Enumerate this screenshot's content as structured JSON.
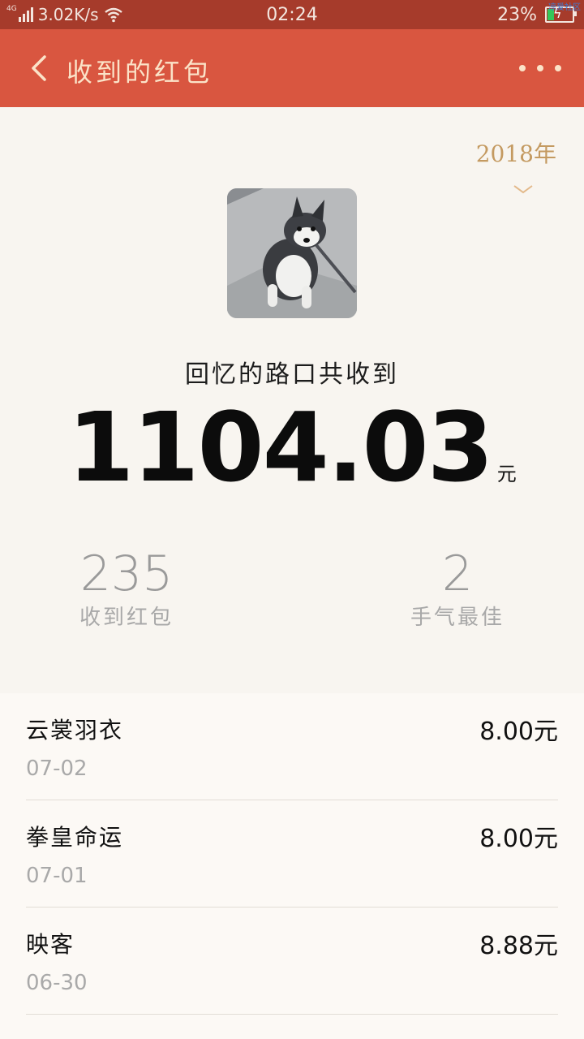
{
  "status_bar": {
    "network_type": "4G",
    "speed": "3.02K/s",
    "time": "02:24",
    "battery": "23%",
    "corner_text": "凉爱社区"
  },
  "app_bar": {
    "title": "收到的红包",
    "back_icon": "chevron-left-icon",
    "more_icon": "more-dots-icon"
  },
  "summary": {
    "year": "2018年",
    "owner_text": "回忆的路口共收到",
    "total": "1104.03",
    "unit": "元",
    "stats": [
      {
        "value": "235",
        "label": "收到红包"
      },
      {
        "value": "2",
        "label": "手气最佳"
      }
    ]
  },
  "list": [
    {
      "name": "云裳羽衣",
      "amount": "8.00元",
      "date": "07-02"
    },
    {
      "name": "拳皇命运",
      "amount": "8.00元",
      "date": "07-01"
    },
    {
      "name": "映客",
      "amount": "8.88元",
      "date": "06-30"
    }
  ],
  "colors": {
    "status_bar": "#a63b2b",
    "app_bar": "#d95640",
    "title_text": "#fbe3c8",
    "year_text": "#c49a61"
  }
}
